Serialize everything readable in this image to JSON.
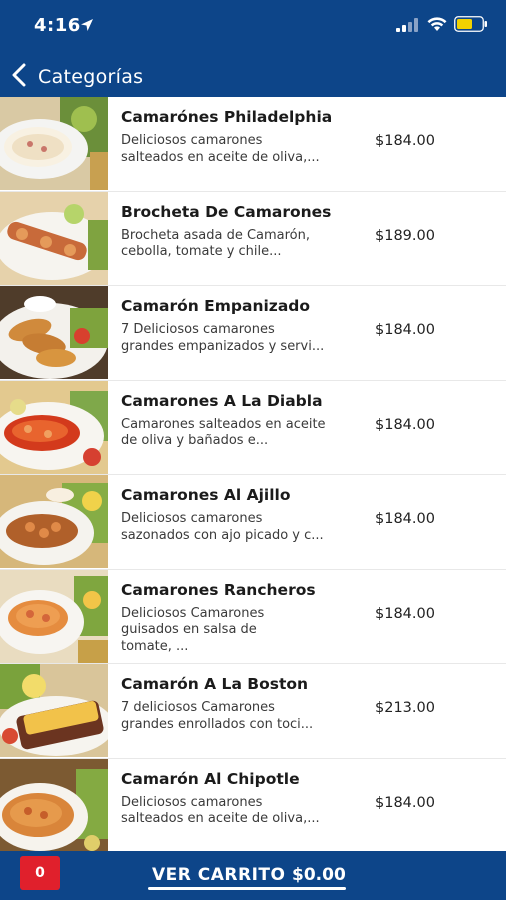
{
  "status_bar": {
    "time": "4:16"
  },
  "nav": {
    "back_label": "Categorías"
  },
  "items": [
    {
      "name": "Camarónes Philadelphia",
      "description": "Deliciosos camarones\nsalteados en aceite de oliva,...",
      "price": "$184.00",
      "image_icon": "dish-photo-icon"
    },
    {
      "name": "Brocheta De Camarones",
      "description": "Brocheta asada de Camarón,\ncebolla, tomate y chile...",
      "price": "$189.00",
      "image_icon": "dish-photo-icon"
    },
    {
      "name": "Camarón Empanizado",
      "description": "7 Deliciosos camarones\ngrandes empanizados y servi...",
      "price": "$184.00",
      "image_icon": "dish-photo-icon"
    },
    {
      "name": "Camarones A La Diabla",
      "description": "Camarones salteados en aceite\nde oliva y bañados e...",
      "price": "$184.00",
      "image_icon": "dish-photo-icon"
    },
    {
      "name": "Camarones Al Ajillo",
      "description": " Deliciosos camarones\nsazonados con ajo picado y c...",
      "price": "$184.00",
      "image_icon": "dish-photo-icon"
    },
    {
      "name": "Camarones Rancheros",
      "description": "Deliciosos Camarones\nguisados en salsa de\ntomate, ...",
      "price": "$184.00",
      "image_icon": "dish-photo-icon"
    },
    {
      "name": "Camarón A La Boston",
      "description": "7 deliciosos Camarones\ngrandes enrollados con toci...",
      "price": "$213.00",
      "image_icon": "dish-photo-icon"
    },
    {
      "name": "Camarón Al Chipotle",
      "description": "Deliciosos camarones\nsalteados en aceite de oliva,...",
      "price": "$184.00",
      "image_icon": "dish-photo-icon"
    }
  ],
  "footer": {
    "cart_count": "0",
    "cart_label": "VER CARRITO",
    "cart_total": "$0.00"
  },
  "colors": {
    "header_bg": "#0d4589",
    "badge_red": "#e0202c"
  }
}
